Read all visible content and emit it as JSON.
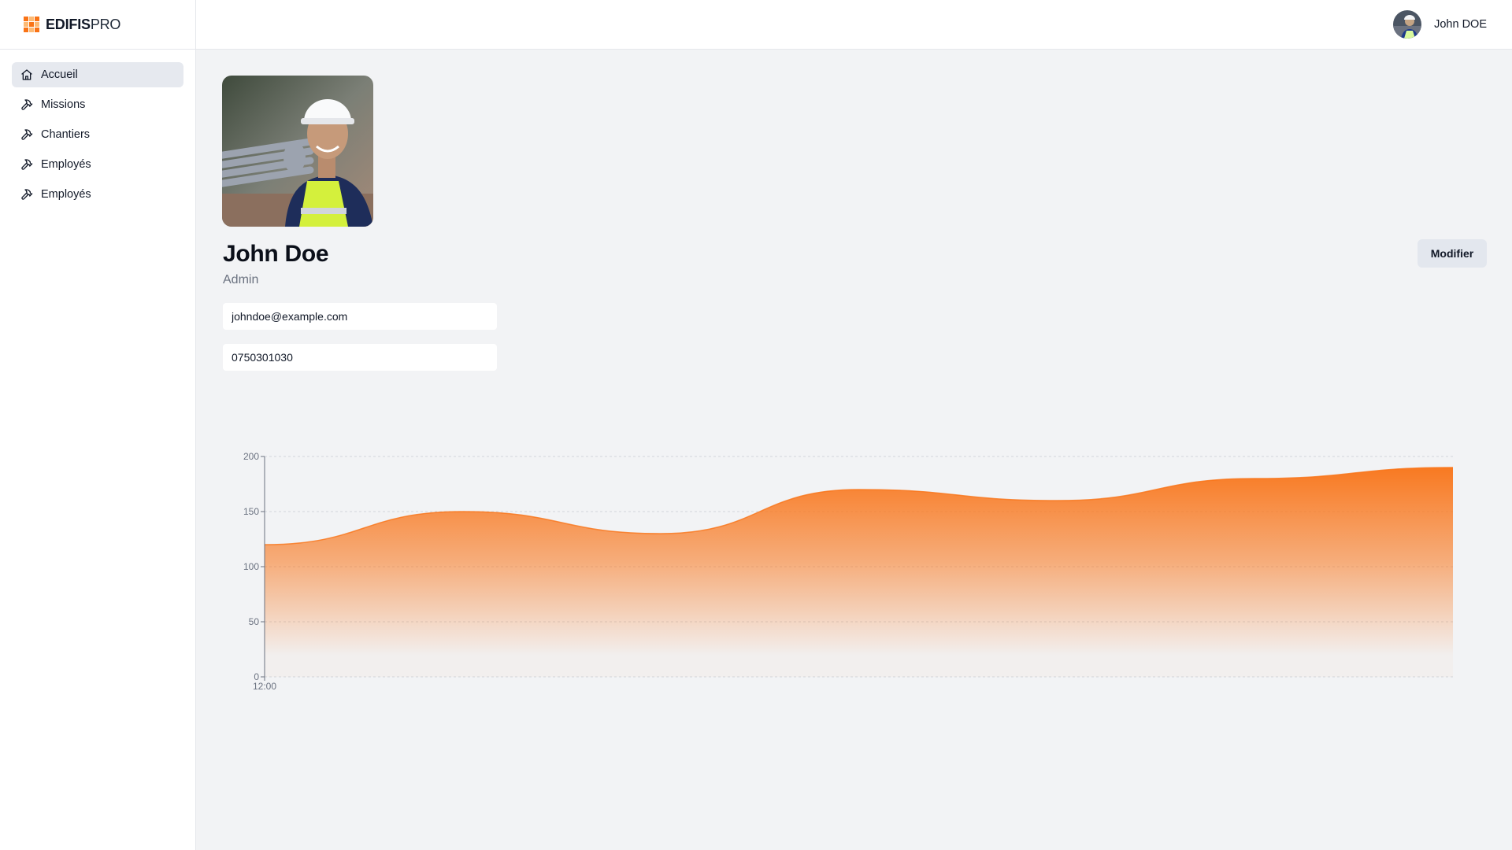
{
  "brand": {
    "name_bold": "EDIFIS",
    "name_light": "PRO"
  },
  "sidebar": {
    "items": [
      {
        "label": "Accueil",
        "icon": "home-icon",
        "active": true
      },
      {
        "label": "Missions",
        "icon": "hammer-icon",
        "active": false
      },
      {
        "label": "Chantiers",
        "icon": "hammer-icon",
        "active": false
      },
      {
        "label": "Employés",
        "icon": "hammer-icon",
        "active": false
      },
      {
        "label": "Employés",
        "icon": "hammer-icon",
        "active": false
      }
    ]
  },
  "header": {
    "user_name": "John DOE"
  },
  "profile": {
    "name": "John Doe",
    "role": "Admin",
    "email": "johndoe@example.com",
    "phone": "0750301030",
    "edit_label": "Modifier"
  },
  "colors": {
    "accent": "#f97316",
    "accent_light": "#fdba74"
  },
  "chart_data": {
    "type": "area",
    "x_tick_labels": [
      "12:00"
    ],
    "values": [
      120,
      150,
      130,
      170,
      160,
      180,
      190
    ],
    "ylim": [
      0,
      200
    ],
    "yticks": [
      0,
      50,
      100,
      150,
      200
    ],
    "grid": true,
    "color": "#f97316"
  }
}
